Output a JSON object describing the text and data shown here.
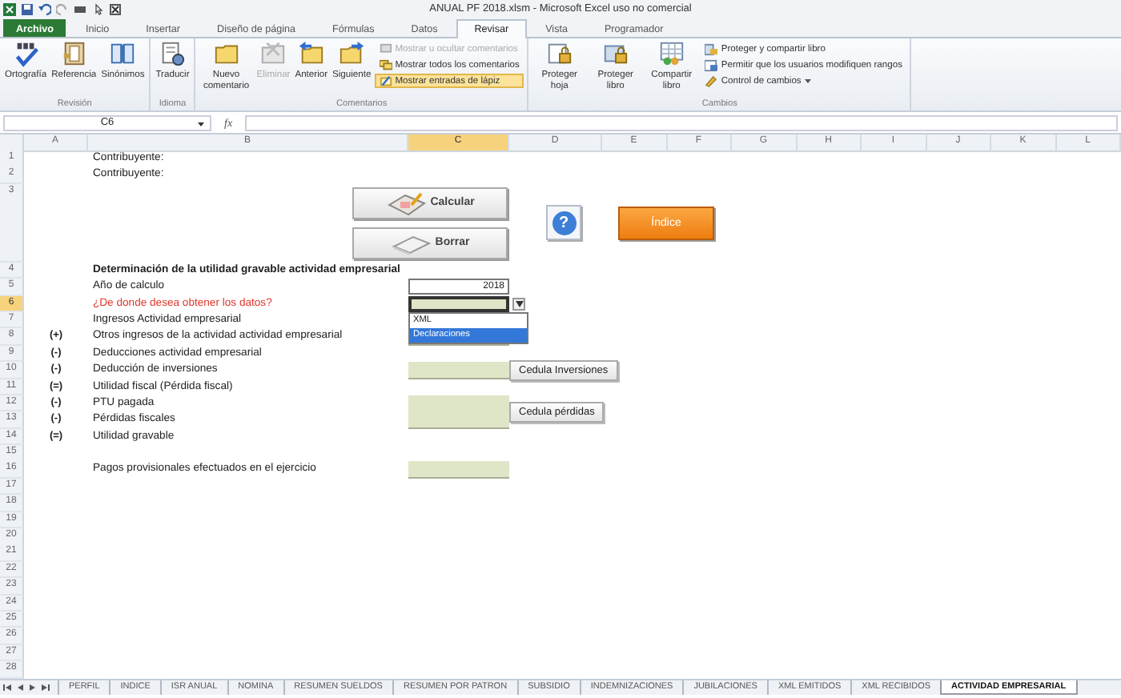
{
  "window": {
    "title": "ANUAL PF 2018.xlsm  -  Microsoft Excel uso no comercial"
  },
  "ribbon_tabs": [
    {
      "label": "Archivo",
      "kind": "file",
      "selected": false
    },
    {
      "label": "Inicio",
      "kind": "tab",
      "selected": false
    },
    {
      "label": "Insertar",
      "kind": "tab",
      "selected": false
    },
    {
      "label": "Diseño de página",
      "kind": "tab",
      "selected": false
    },
    {
      "label": "Fórmulas",
      "kind": "tab",
      "selected": false
    },
    {
      "label": "Datos",
      "kind": "tab",
      "selected": false
    },
    {
      "label": "Revisar",
      "kind": "tab",
      "selected": true
    },
    {
      "label": "Vista",
      "kind": "tab",
      "selected": false
    },
    {
      "label": "Programador",
      "kind": "tab",
      "selected": false
    }
  ],
  "ribbon_groups": [
    {
      "label": "Revisión",
      "large_buttons": [
        {
          "label": "Ortografía",
          "disabled": false
        },
        {
          "label": "Referencia",
          "disabled": false
        },
        {
          "label": "Sinónimos",
          "disabled": false
        }
      ]
    },
    {
      "label": "Idioma",
      "large_buttons": [
        {
          "label": "Traducir",
          "disabled": false
        }
      ]
    },
    {
      "label": "Comentarios",
      "large_buttons": [
        {
          "label": "Nuevo comentario",
          "disabled": false
        },
        {
          "label": "Eliminar",
          "disabled": true
        },
        {
          "label": "Anterior",
          "disabled": false
        },
        {
          "label": "Siguiente",
          "disabled": false
        }
      ],
      "small_buttons": [
        {
          "label": "Mostrar u ocultar comentarios",
          "disabled": true,
          "on": false,
          "has_menu": false
        },
        {
          "label": "Mostrar todos los comentarios",
          "disabled": false,
          "on": false,
          "has_menu": false
        },
        {
          "label": "Mostrar entradas de lápiz",
          "disabled": false,
          "on": true,
          "has_menu": false
        }
      ]
    },
    {
      "label": "Cambios",
      "large_buttons": [
        {
          "label": "Proteger hoja",
          "disabled": false
        },
        {
          "label": "Proteger libro",
          "disabled": false
        },
        {
          "label": "Compartir libro",
          "disabled": false
        }
      ],
      "small_buttons": [
        {
          "label": "Proteger y compartir libro",
          "disabled": false,
          "on": false,
          "has_menu": false
        },
        {
          "label": "Permitir que los usuarios modifiquen rangos",
          "disabled": false,
          "on": false,
          "has_menu": false
        },
        {
          "label": "Control de cambios",
          "disabled": false,
          "on": false,
          "has_menu": true
        }
      ]
    }
  ],
  "formula_bar": {
    "name_box": "C6",
    "function_label": "fx"
  },
  "columns": [
    {
      "label": "A",
      "selected": false
    },
    {
      "label": "B",
      "selected": false
    },
    {
      "label": "C",
      "selected": true
    },
    {
      "label": "D",
      "selected": false
    },
    {
      "label": "E",
      "selected": false
    },
    {
      "label": "F",
      "selected": false
    },
    {
      "label": "G",
      "selected": false
    },
    {
      "label": "H",
      "selected": false
    },
    {
      "label": "I",
      "selected": false
    },
    {
      "label": "J",
      "selected": false
    },
    {
      "label": "K",
      "selected": false
    },
    {
      "label": "L",
      "selected": false
    }
  ],
  "rows": [
    {
      "number": "1",
      "selected": false,
      "label": "Contribuyente:",
      "kind": "plain"
    },
    {
      "number": "2",
      "selected": false,
      "label": "Contribuyente:",
      "kind": "plain"
    },
    {
      "number": "3",
      "selected": false,
      "buttons": [
        {
          "label": "Calcular",
          "kind": "calculate"
        },
        {
          "label": "Borrar",
          "kind": "clear"
        },
        {
          "label": "?",
          "kind": "help"
        },
        {
          "label": "Índice",
          "kind": "index"
        }
      ]
    },
    {
      "number": "4",
      "selected": false,
      "label": "Determinación de la utilidad gravable actividad empresarial",
      "kind": "heading"
    },
    {
      "number": "5",
      "selected": false,
      "label": "Año de calculo",
      "kind": "plain",
      "input": {
        "kind": "value",
        "value": "2018"
      }
    },
    {
      "number": "6",
      "selected": true,
      "label": "¿De donde desea obtener los datos?",
      "kind": "question",
      "input": {
        "kind": "dropdown",
        "options": [
          {
            "label": "XML",
            "selected": false
          },
          {
            "label": "Declaraciones",
            "selected": true
          }
        ]
      }
    },
    {
      "number": "7",
      "selected": false,
      "label": "Ingresos Actividad empresarial",
      "kind": "plain"
    },
    {
      "number": "8",
      "selected": false,
      "sign": "(+)",
      "label": "Otros ingresos de la actividad actividad empresarial",
      "kind": "plain",
      "input": {
        "kind": "entry"
      }
    },
    {
      "number": "9",
      "selected": false,
      "sign": "(-)",
      "label": "Deducciones actividad empresarial",
      "kind": "plain"
    },
    {
      "number": "10",
      "selected": false,
      "sign": "(-)",
      "label": "Deducción de inversiones",
      "kind": "plain",
      "input": {
        "kind": "entry"
      },
      "side_button": "Cedula Inversiones"
    },
    {
      "number": "11",
      "selected": false,
      "sign": "(=)",
      "label": "Utilidad fiscal (Pérdida fiscal)",
      "kind": "plain"
    },
    {
      "number": "12",
      "selected": false,
      "sign": "(-)",
      "label": "PTU pagada",
      "kind": "plain",
      "input": {
        "kind": "entry_top"
      },
      "side_button": "Cedula pérdidas"
    },
    {
      "number": "13",
      "selected": false,
      "sign": "(-)",
      "label": "Pérdidas fiscales",
      "kind": "plain",
      "input": {
        "kind": "entry"
      }
    },
    {
      "number": "14",
      "selected": false,
      "sign": "(=)",
      "label": "Utilidad gravable",
      "kind": "plain"
    },
    {
      "number": "15",
      "selected": false
    },
    {
      "number": "16",
      "selected": false,
      "label": "Pagos provisionales efectuados en el ejercicio",
      "kind": "plain",
      "input": {
        "kind": "entry"
      }
    },
    {
      "number": "17",
      "selected": false
    },
    {
      "number": "18",
      "selected": false
    },
    {
      "number": "19",
      "selected": false
    },
    {
      "number": "20",
      "selected": false
    },
    {
      "number": "21",
      "selected": false
    },
    {
      "number": "22",
      "selected": false
    },
    {
      "number": "23",
      "selected": false
    },
    {
      "number": "24",
      "selected": false
    },
    {
      "number": "25",
      "selected": false
    },
    {
      "number": "26",
      "selected": false
    },
    {
      "number": "27",
      "selected": false
    },
    {
      "number": "28",
      "selected": false
    }
  ],
  "sheet_tabs": [
    {
      "label": "PERFIL",
      "selected": false
    },
    {
      "label": "INDICE",
      "selected": false
    },
    {
      "label": "ISR ANUAL",
      "selected": false
    },
    {
      "label": "NOMINA",
      "selected": false
    },
    {
      "label": "RESUMEN SUELDOS",
      "selected": false
    },
    {
      "label": "RESUMEN POR PATRON",
      "selected": false
    },
    {
      "label": "SUBSIDIO",
      "selected": false
    },
    {
      "label": "INDEMNIZACIONES",
      "selected": false
    },
    {
      "label": "JUBILACIONES",
      "selected": false
    },
    {
      "label": "XML EMITIDOS",
      "selected": false
    },
    {
      "label": "XML RECIBIDOS",
      "selected": false
    },
    {
      "label": "ACTIVIDAD EMPRESARIAL",
      "selected": true
    }
  ]
}
